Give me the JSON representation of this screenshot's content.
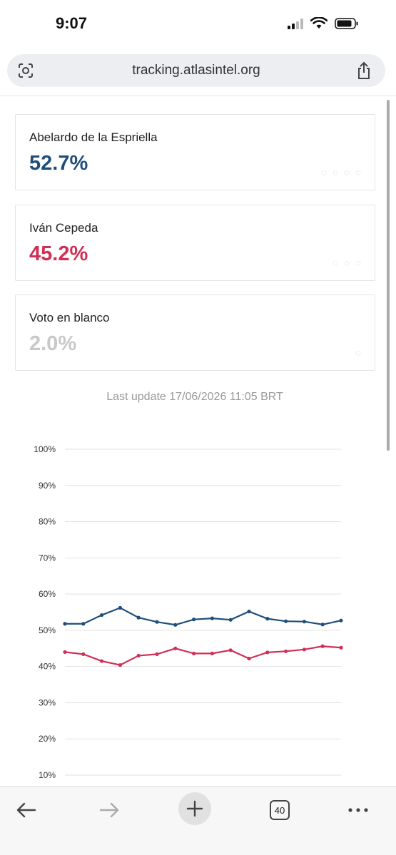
{
  "status_bar": {
    "time": "9:07"
  },
  "browser": {
    "url": "tracking.atlasintel.org",
    "tab_count": "40"
  },
  "candidates": [
    {
      "name": "Abelardo de la Espriella",
      "value": "52.7%",
      "color": "#1f4e79"
    },
    {
      "name": "Iván Cepeda",
      "value": "45.2%",
      "color": "#d12f56"
    },
    {
      "name": "Voto en blanco",
      "value": "2.0%",
      "color": "#c8c8c8"
    }
  ],
  "last_update": "Last update 17/06/2026 11:05 BRT",
  "chart_data": {
    "type": "line",
    "ylim": [
      10,
      100
    ],
    "yticks": [
      "10%",
      "20%",
      "30%",
      "40%",
      "50%",
      "60%",
      "70%",
      "80%",
      "90%",
      "100%"
    ],
    "grid": true,
    "series": [
      {
        "color": "#1f4e79",
        "values": [
          51.8,
          51.8,
          54.2,
          56.2,
          53.5,
          52.3,
          51.5,
          53.0,
          53.3,
          52.9,
          55.2,
          53.2,
          52.5,
          52.4,
          51.6,
          52.7
        ]
      },
      {
        "color": "#d12f56",
        "values": [
          44.0,
          43.4,
          41.5,
          40.4,
          43.0,
          43.4,
          45.0,
          43.6,
          43.6,
          44.5,
          42.2,
          43.9,
          44.2,
          44.7,
          45.6,
          45.2
        ]
      }
    ]
  }
}
